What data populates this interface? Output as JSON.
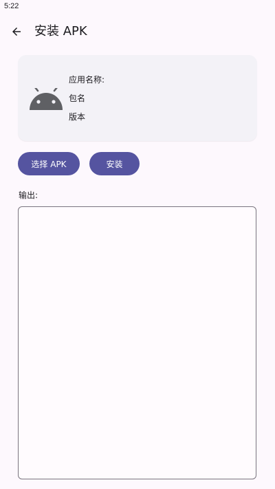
{
  "status_bar": {
    "time": "5:22"
  },
  "top_bar": {
    "back_icon": "arrow-back-icon",
    "title": "安装 APK"
  },
  "app_card": {
    "icon": "android-icon",
    "icon_color": "#5f6064",
    "app_name_label": "应用名称:",
    "package_label": "包名",
    "version_label": "版本"
  },
  "actions": {
    "select_apk_label": "选择 APK",
    "install_label": "安装",
    "button_color": "#5554a0"
  },
  "output": {
    "label": "输出:",
    "text": ""
  }
}
